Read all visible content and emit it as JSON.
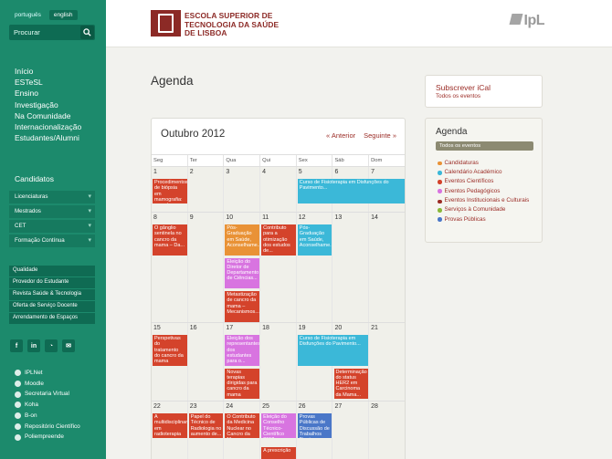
{
  "lang": {
    "pt": "português",
    "en": "english"
  },
  "search": {
    "label": "Procurar"
  },
  "mainnav": [
    "Início",
    "ESTeSL",
    "Ensino",
    "Investigação",
    "Na Comunidade",
    "Internacionalização",
    "Estudantes/Alumni"
  ],
  "candidatos": {
    "title": "Candidatos",
    "items": [
      "Licenciaturas",
      "Mestrados",
      "CET",
      "Formação Contínua"
    ]
  },
  "links": [
    "Qualidade",
    "Provedor do Estudante",
    "Revista Saúde & Tecnologia",
    "Oferta de Serviço Docente",
    "Arrendamento de Espaços"
  ],
  "social": [
    "f",
    "in",
    "rss",
    "mail"
  ],
  "resources": [
    "IPLNet",
    "Moodle",
    "Secretaria Virtual",
    "Koha",
    "B-on",
    "Repositório Científico",
    "Poliempreende"
  ],
  "header": {
    "school": [
      "ESCOLA SUPERIOR DE",
      "TECNOLOGIA DA SAÚDE",
      "DE LISBOA"
    ],
    "ipl": "IpL"
  },
  "page": {
    "title": "Agenda"
  },
  "calendar": {
    "month": "Outubro 2012",
    "prev": "« Anterior",
    "next": "Seguinte »",
    "days": [
      "Seg",
      "Ter",
      "Qua",
      "Qui",
      "Sex",
      "Sáb",
      "Dom"
    ],
    "weeks": [
      {
        "dates": [
          "1",
          "2",
          "3",
          "4",
          "5",
          "6",
          "7"
        ],
        "events": [
          {
            "col": 0,
            "span": 1,
            "row": 0,
            "h": 4,
            "color": "red",
            "text": "Procedimentos de biópsia em mamografia: a ponte..."
          },
          {
            "col": 4,
            "span": 3,
            "row": 0,
            "h": 4,
            "color": "cyan",
            "text": "Curso de Fisioterapia em Disfunções do Pavimento..."
          }
        ]
      },
      {
        "dates": [
          "8",
          "9",
          "10",
          "11",
          "12",
          "13",
          "14"
        ],
        "events": [
          {
            "col": 0,
            "span": 1,
            "row": 0,
            "h": 5,
            "color": "red",
            "text": "O gânglio sentinela no cancro da mama – Da..."
          },
          {
            "col": 2,
            "span": 1,
            "row": 0,
            "h": 5,
            "color": "orange",
            "text": "Pós-Graduação em Saúde, Aconselhame..."
          },
          {
            "col": 3,
            "span": 1,
            "row": 0,
            "h": 5,
            "color": "red",
            "text": "Contributo para a otimização dos estudos de..."
          },
          {
            "col": 4,
            "span": 1,
            "row": 0,
            "h": 5,
            "color": "cyan",
            "text": "Pós-Graduação em Saúde, Aconselhame..."
          },
          {
            "col": 2,
            "span": 1,
            "row": 1,
            "h": 5,
            "color": "pink",
            "text": "Eleição do Diretor de Departamento de Ciências..."
          },
          {
            "col": 2,
            "span": 1,
            "row": 2,
            "h": 5,
            "color": "red",
            "text": "Metastização de cancro da mama – Mecanismos..."
          }
        ]
      },
      {
        "dates": [
          "15",
          "16",
          "17",
          "18",
          "19",
          "20",
          "21"
        ],
        "events": [
          {
            "col": 0,
            "span": 1,
            "row": 0,
            "h": 5,
            "color": "red",
            "text": "Perspetivas do tratamento do cancro da mama"
          },
          {
            "col": 2,
            "span": 1,
            "row": 0,
            "h": 5,
            "color": "pink",
            "text": "Eleição dos representantes dos estudantes para o..."
          },
          {
            "col": 4,
            "span": 2,
            "row": 0,
            "h": 5,
            "color": "cyan",
            "text": "Curso de Fisioterapia em Disfunções do Pavimento..."
          },
          {
            "col": 2,
            "span": 1,
            "row": 1,
            "h": 5,
            "color": "red",
            "text": "Novas terapias dirigidas para cancro da mama"
          },
          {
            "col": 5,
            "span": 1,
            "row": 1,
            "h": 5,
            "color": "red",
            "text": "Determinação do status HER2 em Carcinoma da Mama..."
          }
        ]
      },
      {
        "dates": [
          "22",
          "23",
          "24",
          "25",
          "26",
          "27",
          "28"
        ],
        "events": [
          {
            "col": 0,
            "span": 1,
            "row": 0,
            "h": 4,
            "color": "red",
            "text": "A multidisciplinaridade em radioterapia"
          },
          {
            "col": 1,
            "span": 1,
            "row": 0,
            "h": 4,
            "color": "red",
            "text": "Papel do Técnico de Radiologia no aumento de..."
          },
          {
            "col": 2,
            "span": 1,
            "row": 0,
            "h": 4,
            "color": "red",
            "text": "O Contributo da Medicina Nuclear no Cancro da Mama"
          },
          {
            "col": 3,
            "span": 1,
            "row": 0,
            "h": 4,
            "color": "pink",
            "text": "Eleição do Conselho Técnico-Científico 2012"
          },
          {
            "col": 4,
            "span": 1,
            "row": 0,
            "h": 4,
            "color": "blue",
            "text": "Provas Públicas de Discussão de Trabalhos Finais"
          },
          {
            "col": 3,
            "span": 1,
            "row": 1,
            "h": 2,
            "color": "red",
            "text": "A prescrição"
          }
        ]
      }
    ]
  },
  "ical": {
    "title": "Subscrever iCal",
    "sub": "Todos os eventos"
  },
  "agenda": {
    "title": "Agenda",
    "all": "Todos os eventos",
    "cats": [
      {
        "label": "Candidaturas",
        "color": "#e99236"
      },
      {
        "label": "Calendário Académico",
        "color": "#3bb8d8"
      },
      {
        "label": "Eventos Científicos",
        "color": "#d4432b"
      },
      {
        "label": "Eventos Pedagógicos",
        "color": "#d874e0"
      },
      {
        "label": "Eventos Institucionais e Culturais",
        "color": "#9b2c26"
      },
      {
        "label": "Serviços à Comunidade",
        "color": "#8ab83a"
      },
      {
        "label": "Provas Públicas",
        "color": "#4a77c8"
      }
    ]
  }
}
